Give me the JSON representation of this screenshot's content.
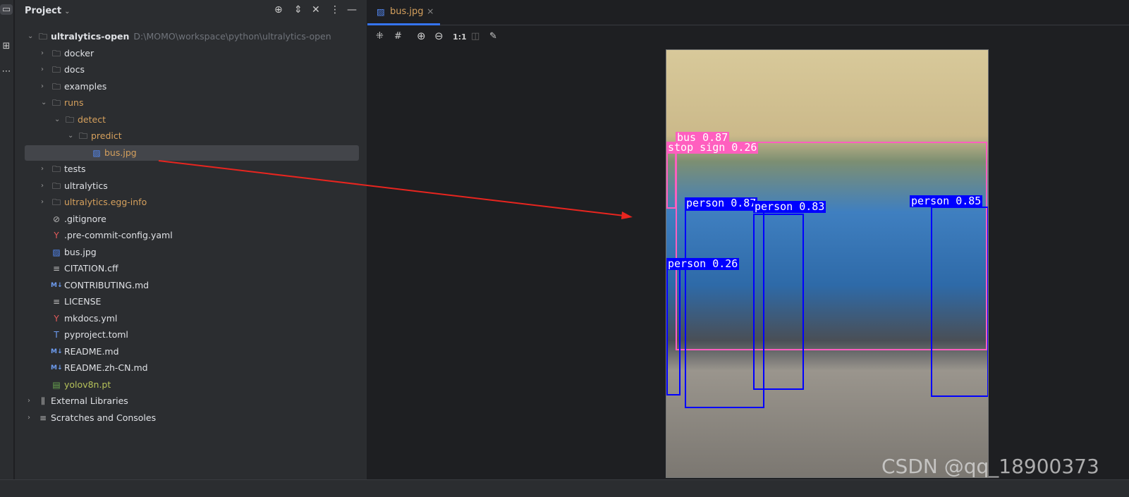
{
  "panel": {
    "title": "Project"
  },
  "tree": [
    {
      "label": "ultralytics-open",
      "path": "D:\\MOMO\\workspace\\python\\ultralytics-open",
      "level": 0,
      "open": true,
      "icon": "folder-icon",
      "bold": true
    },
    {
      "label": "docker",
      "level": 1,
      "icon": "folder-icon"
    },
    {
      "label": "docs",
      "level": 1,
      "icon": "folder-icon"
    },
    {
      "label": "examples",
      "level": 1,
      "icon": "folder-icon"
    },
    {
      "label": "runs",
      "level": 1,
      "open": true,
      "icon": "folder-icon",
      "color": "orange"
    },
    {
      "label": "detect",
      "level": 2,
      "open": true,
      "icon": "folder-icon",
      "color": "orange"
    },
    {
      "label": "predict",
      "level": 3,
      "open": true,
      "icon": "folder-icon",
      "color": "orange"
    },
    {
      "label": "bus.jpg",
      "level": 4,
      "icon": "image-icon",
      "color": "orange",
      "selected": true
    },
    {
      "label": "tests",
      "level": 1,
      "icon": "package-folder-icon"
    },
    {
      "label": "ultralytics",
      "level": 1,
      "icon": "package-folder-icon"
    },
    {
      "label": "ultralytics.egg-info",
      "level": 1,
      "icon": "folder-icon",
      "color": "orange"
    },
    {
      "label": ".gitignore",
      "level": 1,
      "leaf": true,
      "icon": "ignore-icon"
    },
    {
      "label": ".pre-commit-config.yaml",
      "level": 1,
      "leaf": true,
      "icon": "yaml-icon"
    },
    {
      "label": "bus.jpg",
      "level": 1,
      "leaf": true,
      "icon": "image-icon"
    },
    {
      "label": "CITATION.cff",
      "level": 1,
      "leaf": true,
      "icon": "text-icon"
    },
    {
      "label": "CONTRIBUTING.md",
      "level": 1,
      "leaf": true,
      "icon": "markdown-icon"
    },
    {
      "label": "LICENSE",
      "level": 1,
      "leaf": true,
      "icon": "text-icon"
    },
    {
      "label": "mkdocs.yml",
      "level": 1,
      "leaf": true,
      "icon": "yaml-icon"
    },
    {
      "label": "pyproject.toml",
      "level": 1,
      "leaf": true,
      "icon": "toml-icon"
    },
    {
      "label": "README.md",
      "level": 1,
      "leaf": true,
      "icon": "markdown-icon"
    },
    {
      "label": "README.zh-CN.md",
      "level": 1,
      "leaf": true,
      "icon": "markdown-icon"
    },
    {
      "label": "yolov8n.pt",
      "level": 1,
      "leaf": true,
      "icon": "file-icon",
      "color": "green"
    },
    {
      "label": "External Libraries",
      "level": 0,
      "icon": "library-icon"
    },
    {
      "label": "Scratches and Consoles",
      "level": 0,
      "icon": "scratches-icon"
    }
  ],
  "editor": {
    "tab": "bus.jpg",
    "zoom_actual": "1:1"
  },
  "detections": [
    {
      "label": "bus 0.87",
      "color": "pink"
    },
    {
      "label": "stop sign 0.26",
      "color": "pink"
    },
    {
      "label": "person 0.87",
      "color": "blue"
    },
    {
      "label": "person 0.83",
      "color": "blue"
    },
    {
      "label": "person 0.85",
      "color": "blue"
    },
    {
      "label": "person 0.26",
      "color": "blue"
    }
  ],
  "watermark": "CSDN @qq_18900373",
  "colors": {
    "accent": "#3574f0",
    "person_box": "#0000ff",
    "bus_box": "#ff5fbf",
    "arrow": "#e8251f"
  }
}
